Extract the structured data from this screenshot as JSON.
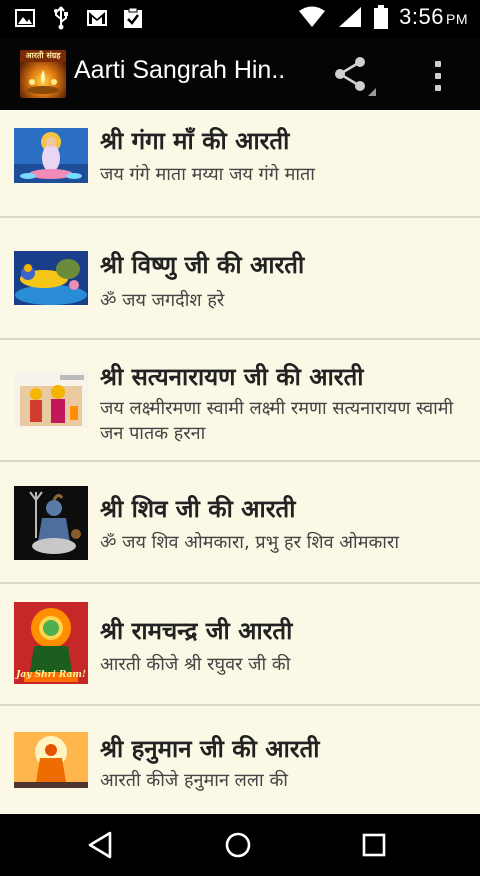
{
  "status_bar": {
    "time": "3:56",
    "ampm": "PM",
    "left_icons": [
      "image-icon",
      "usb-icon",
      "gmail-icon",
      "clipboard-check-icon"
    ],
    "right_icons": [
      "wifi-icon",
      "signal-icon",
      "battery-icon"
    ]
  },
  "app_bar": {
    "title": "Aarti Sangrah Hin..",
    "icon_label": "आरती संग्रह",
    "actions": [
      "share-icon",
      "overflow-menu-icon"
    ]
  },
  "list": {
    "items": [
      {
        "title": "श्री गंगा माँ की आरती",
        "subtitle": "जय गंगे माता मय्या जय गंगे माता"
      },
      {
        "title": "श्री विष्णु जी की आरती",
        "subtitle": "ॐ जय जगदीश हरे"
      },
      {
        "title": "श्री सत्यनारायण जी की आरती",
        "subtitle": "जय लक्ष्मीरमणा स्वामी लक्ष्मी  रमणा सत्यनारायण स्वामी  जन  पातक  हरना"
      },
      {
        "title": "श्री शिव जी की आरती",
        "subtitle": "ॐ जय शिव ओमकारा, प्रभु हर शिव ओमकारा"
      },
      {
        "title": "श्री रामचन्द्र जी आरती",
        "subtitle": "आरती कीजे श्री रघुवर जी की",
        "thumb_caption": "Jay Shri Ram!"
      },
      {
        "title": "श्री हनुमान जी की आरती",
        "subtitle": "आरती कीजे हनुमान लला की"
      }
    ]
  },
  "nav_bar": {
    "buttons": [
      "back-icon",
      "home-icon",
      "recents-icon"
    ]
  },
  "colors": {
    "list_background": "#fbf8e6",
    "divider": "#dcd8c6",
    "bar_background": "#000000",
    "title_text": "#222222"
  }
}
